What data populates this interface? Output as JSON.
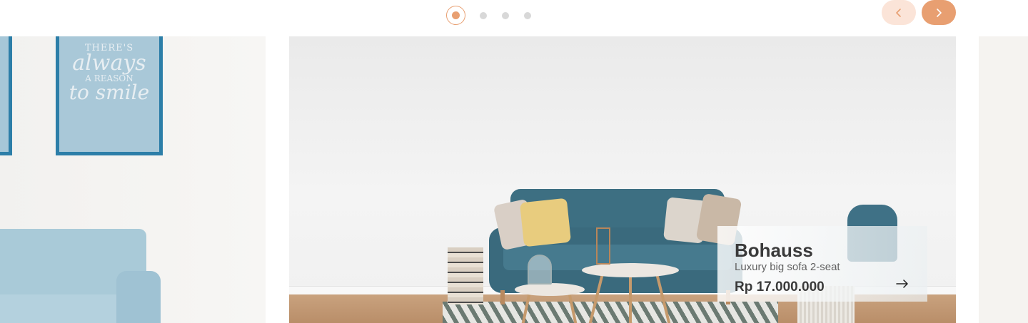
{
  "carousel": {
    "dots": [
      {
        "active": true
      },
      {
        "active": false
      },
      {
        "active": false
      },
      {
        "active": false
      }
    ],
    "prev_icon": "chevron-left-icon",
    "next_icon": "chevron-right-icon"
  },
  "slides": {
    "left": {
      "poster_line1": "THERE'S",
      "poster_line2": "always",
      "poster_line3": "A REASON",
      "poster_line4": "to smile"
    }
  },
  "product": {
    "name": "Bohauss",
    "description": "Luxury big sofa 2-seat",
    "price": "Rp 17.000.000",
    "arrow_icon": "arrow-right-icon"
  },
  "colors": {
    "accent": "#e89f71",
    "accent_light": "#fbe4d8",
    "dot_inactive": "#d8d8d8",
    "text_dark": "#3a3a3a",
    "text_muted": "#616161"
  }
}
